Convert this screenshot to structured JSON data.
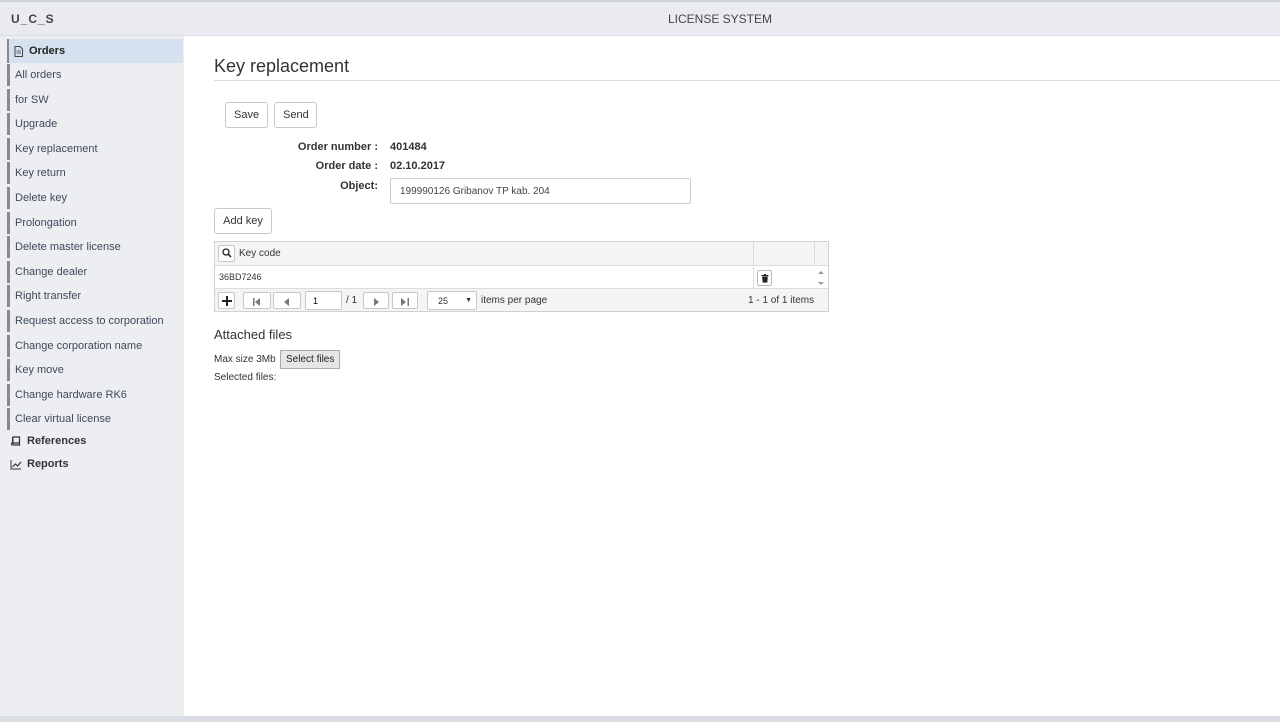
{
  "header": {
    "brand": "U_C_S",
    "title": "LICENSE SYSTEM"
  },
  "sidebar": {
    "top": {
      "label": "Orders",
      "icon": "document-icon"
    },
    "items": [
      {
        "label": "All orders"
      },
      {
        "label": "for SW"
      },
      {
        "label": "Upgrade"
      },
      {
        "label": "Key replacement"
      },
      {
        "label": "Key return"
      },
      {
        "label": "Delete key"
      },
      {
        "label": "Prolongation"
      },
      {
        "label": "Delete master license"
      },
      {
        "label": "Change dealer"
      },
      {
        "label": "Right transfer"
      },
      {
        "label": "Request access to corporation"
      },
      {
        "label": "Change corporation name"
      },
      {
        "label": "Key move"
      },
      {
        "label": "Change hardware RK6"
      },
      {
        "label": "Clear virtual license"
      }
    ],
    "sections": [
      {
        "label": "References",
        "icon": "book-icon"
      },
      {
        "label": "Reports",
        "icon": "chart-icon"
      }
    ]
  },
  "main": {
    "title": "Key replacement",
    "toolbar": {
      "save_label": "Save",
      "send_label": "Send"
    },
    "form": {
      "order_number_label": "Order number :",
      "order_number": "401484",
      "order_date_label": "Order date :",
      "order_date": "02.10.2017",
      "object_label": "Object:",
      "object_value": "199990126 Gribanov TP kab. 204"
    },
    "add_key_label": "Add key",
    "grid": {
      "header": "Key code",
      "rows": [
        {
          "key_code": "36BD7246"
        }
      ],
      "pager": {
        "page": "1",
        "of_pages": "/ 1",
        "page_size": "25",
        "items_per_page_label": "items per page",
        "summary": "1 - 1 of 1 items"
      }
    },
    "attachments": {
      "title": "Attached files",
      "max_size": "Max size 3Mb",
      "select_label": "Select files",
      "selected_label": "Selected files:"
    }
  },
  "colors": {
    "sidebar_bg": "#eceef2",
    "active_item": "#d6e1f0",
    "topbar_bg": "#e9ebf0"
  }
}
